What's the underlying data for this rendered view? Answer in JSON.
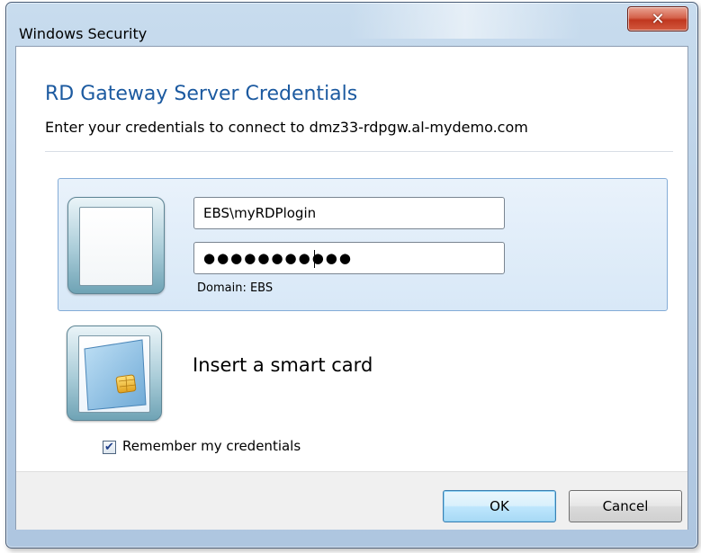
{
  "window": {
    "title": "Windows Security",
    "close_glyph": "✕"
  },
  "dialog": {
    "heading": "RD Gateway Server Credentials",
    "subtitle": "Enter your credentials to connect to dmz33-rdpgw.al-mydemo.com"
  },
  "credentials": {
    "username_value": "EBS\\myRDPlogin",
    "password_masked": "●●●●●●●●●●●",
    "domain_text": "Domain: EBS",
    "user_tile_icon": "user-tile-icon"
  },
  "smart_card": {
    "label": "Insert a smart card",
    "icon": "smart-card-icon"
  },
  "remember": {
    "label": "Remember my credentials",
    "checked": true,
    "check_glyph": "✔"
  },
  "buttons": {
    "ok_label": "OK",
    "cancel_label": "Cancel"
  },
  "colors": {
    "heading": "#1c5aa0",
    "tile_border": "#84acd7",
    "close_red": "#c0371f"
  }
}
